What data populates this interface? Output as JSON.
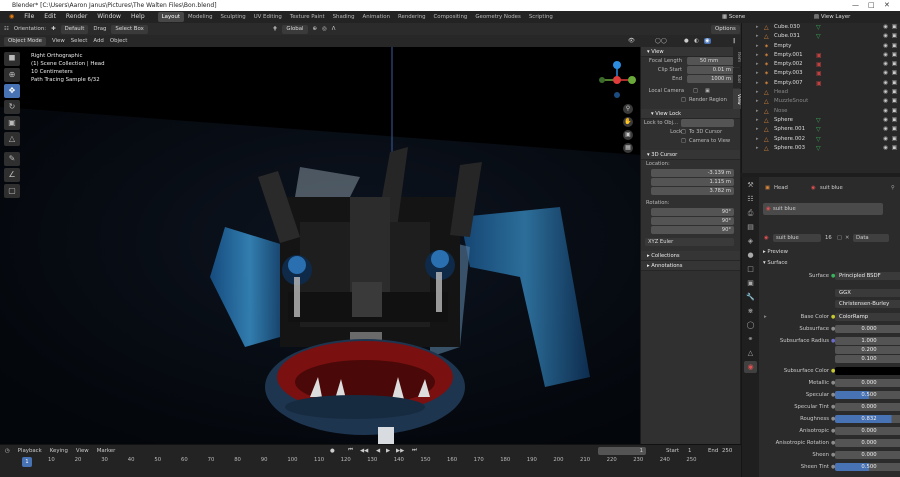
{
  "window_title": "Blender* [C:\\Users\\Aaron Janus\\Pictures\\The Walten Files\\Bon.blend]",
  "menus": [
    "File",
    "Edit",
    "Render",
    "Window",
    "Help"
  ],
  "workspaces": [
    "Layout",
    "Modeling",
    "Sculpting",
    "UV Editing",
    "Texture Paint",
    "Shading",
    "Animation",
    "Rendering",
    "Compositing",
    "Geometry Nodes",
    "Scripting"
  ],
  "active_workspace": "Layout",
  "scene": "Scene",
  "view_layer": "View Layer",
  "header": {
    "orientation_label": "Orientation:",
    "orientation_value": "Default",
    "drag_label": "Drag",
    "drag_value": "Select Box",
    "transform_orientation": "Global",
    "options": "Options"
  },
  "header2": {
    "mode": "Object Mode",
    "items": [
      "View",
      "Select",
      "Add",
      "Object"
    ]
  },
  "viewport_info": [
    "Right Orthographic",
    "(1) Scene Collection | Head",
    "10 Centimeters",
    "Path Tracing Sample 6/32"
  ],
  "npanel": {
    "tabs": [
      "Item",
      "Tool",
      "View"
    ],
    "view_section": "View",
    "focal_length_label": "Focal Length",
    "focal_length": "50 mm",
    "clip_start_label": "Clip Start",
    "clip_start": "0.01 m",
    "clip_end_label": "End",
    "clip_end": "1000 m",
    "local_camera_label": "Local Camera",
    "render_region": "Render Region",
    "view_lock_section": "View Lock",
    "lock_to_obj_label": "Lock to Obj...",
    "lock_label": "Lock",
    "to_3d_cursor": "To 3D Cursor",
    "camera_to_view": "Camera to View",
    "cursor_section": "3D Cursor",
    "location_label": "Location:",
    "loc_x": "-3.139 m",
    "loc_y": "1.115 m",
    "loc_z": "3.782 m",
    "rotation_label": "Rotation:",
    "rot_x": "90°",
    "rot_y": "90°",
    "rot_z": "90°",
    "rotation_mode": "XYZ Euler",
    "collections_section": "Collections",
    "annotations_section": "Annotations"
  },
  "outliner": [
    {
      "name": "Cube.030",
      "dim": false
    },
    {
      "name": "Cube.031",
      "dim": false
    },
    {
      "name": "Empty",
      "dim": false
    },
    {
      "name": "Empty.001",
      "dim": false
    },
    {
      "name": "Empty.002",
      "dim": false
    },
    {
      "name": "Empty.003",
      "dim": false
    },
    {
      "name": "Empty.007",
      "dim": false
    },
    {
      "name": "Head",
      "dim": true
    },
    {
      "name": "MuzzleSnout",
      "dim": true
    },
    {
      "name": "Nose",
      "dim": true
    },
    {
      "name": "Sphere",
      "dim": false
    },
    {
      "name": "Sphere.001",
      "dim": false
    },
    {
      "name": "Sphere.002",
      "dim": false
    },
    {
      "name": "Sphere.003",
      "dim": false
    }
  ],
  "properties": {
    "object": "Head",
    "material": "suit blue",
    "slot": "suit blue",
    "material_name": "suit blue",
    "users": "16",
    "data": "Data",
    "preview": "Preview",
    "surface_section": "Surface",
    "surface_label": "Surface",
    "surface_shader": "Principled BSDF",
    "distribution": "GGX",
    "subsurface_method": "Christensen-Burley",
    "base_color_label": "Base Color",
    "base_color": "ColorRamp",
    "subsurface_label": "Subsurface",
    "subsurface": "0.000",
    "subsurface_radius_label": "Subsurface Radius",
    "subsurface_radius": [
      "1.000",
      "0.200",
      "0.100"
    ],
    "subsurface_color_label": "Subsurface Color",
    "metallic_label": "Metallic",
    "metallic": "0.000",
    "specular_label": "Specular",
    "specular": "0.500",
    "specular_tint_label": "Specular Tint",
    "specular_tint": "0.000",
    "roughness_label": "Roughness",
    "roughness": "0.832",
    "anisotropic_label": "Anisotropic",
    "anisotropic": "0.000",
    "anisotropic_rotation_label": "Anisotropic Rotation",
    "anisotropic_rotation": "0.000",
    "sheen_label": "Sheen",
    "sheen": "0.000",
    "sheen_tint_label": "Sheen Tint",
    "sheen_tint": "0.500"
  },
  "timeline": {
    "menus": [
      "Playback",
      "Keying",
      "View",
      "Marker"
    ],
    "current_frame": "1",
    "start_label": "Start",
    "start": "1",
    "end_label": "End",
    "end": "250",
    "ticks": [
      "10",
      "20",
      "30",
      "40",
      "50",
      "60",
      "70",
      "80",
      "90",
      "100",
      "110",
      "120",
      "130",
      "140",
      "150",
      "160",
      "170",
      "180",
      "190",
      "200",
      "210",
      "220",
      "230",
      "240",
      "250"
    ]
  },
  "accent": "#4772b3"
}
